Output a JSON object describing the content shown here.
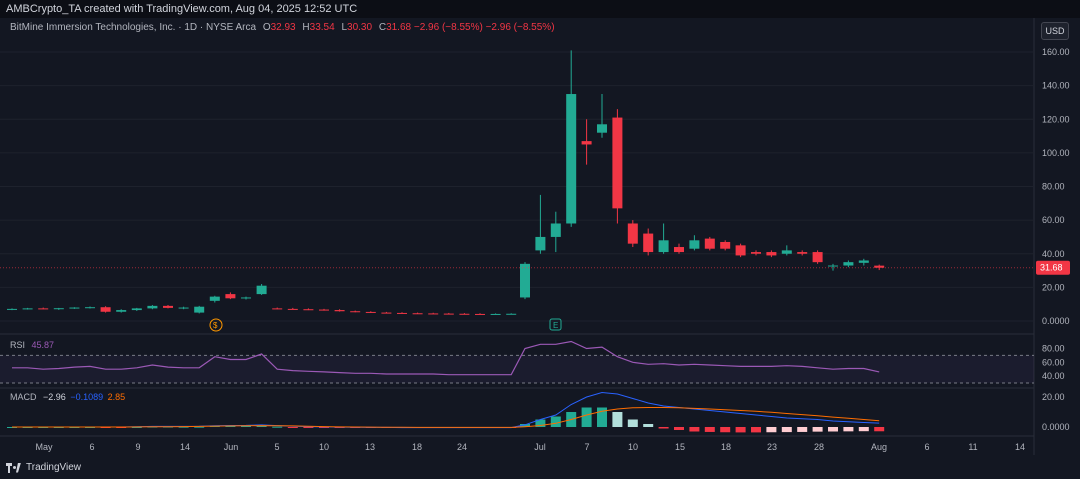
{
  "header": {
    "attribution": "AMBCrypto_TA created with TradingView.com, Aug 04, 2025 12:52 UTC"
  },
  "symbol": {
    "name": "BitMine Immersion Technologies, Inc. · 1D · NYSE Arca",
    "open_label": "O",
    "open": "32.93",
    "high_label": "H",
    "high": "33.54",
    "low_label": "L",
    "low": "30.30",
    "close_label": "C",
    "close": "31.68",
    "change": "−2.96 (−8.55%)",
    "change2": "−2.96 (−8.55%)"
  },
  "currency_button": "USD",
  "price_tag": "31.68",
  "price_axis": [
    "160.00",
    "140.00",
    "120.00",
    "100.00",
    "80.00",
    "60.00",
    "40.00",
    "20.00",
    "0.0000"
  ],
  "rsi": {
    "label": "RSI",
    "value": "45.87",
    "axis": [
      "80.00",
      "60.00",
      "40.00"
    ]
  },
  "macd": {
    "label": "MACD",
    "macd": "−2.96",
    "signal": "−0.1089",
    "hist": "2.85",
    "axis": [
      "20.00",
      "0.0000"
    ]
  },
  "time_axis": [
    "May",
    "6",
    "9",
    "14",
    "Jun",
    "5",
    "10",
    "13",
    "18",
    "24",
    "Jul",
    "7",
    "10",
    "15",
    "18",
    "23",
    "28",
    "Aug",
    "6",
    "11",
    "14"
  ],
  "markers": {
    "dividend": "$",
    "earnings": "E"
  },
  "brand": "TradingView",
  "colors": {
    "up": "#22ab94",
    "down": "#f23645",
    "rsi": "#9b59b6",
    "macd": "#2962ff",
    "signal": "#ff6d00"
  },
  "chart_data": {
    "type": "candlestick",
    "y_range": [
      0,
      165
    ],
    "candles": [
      {
        "o": 7,
        "h": 7.5,
        "l": 6.5,
        "c": 7.2
      },
      {
        "o": 7.2,
        "h": 7.8,
        "l": 6.8,
        "c": 7.5
      },
      {
        "o": 7.5,
        "h": 8,
        "l": 7,
        "c": 7.3
      },
      {
        "o": 7.3,
        "h": 7.8,
        "l": 6.6,
        "c": 7.6
      },
      {
        "o": 7.6,
        "h": 8.2,
        "l": 7.2,
        "c": 8.0
      },
      {
        "o": 8.0,
        "h": 8.6,
        "l": 7.4,
        "c": 8.2
      },
      {
        "o": 8.2,
        "h": 8.8,
        "l": 5,
        "c": 5.5
      },
      {
        "o": 5.5,
        "h": 7,
        "l": 5,
        "c": 6.5
      },
      {
        "o": 6.5,
        "h": 7.8,
        "l": 6,
        "c": 7.5
      },
      {
        "o": 7.5,
        "h": 9.5,
        "l": 7,
        "c": 9
      },
      {
        "o": 9,
        "h": 9.5,
        "l": 7.5,
        "c": 7.8
      },
      {
        "o": 7.8,
        "h": 8.5,
        "l": 7,
        "c": 8
      },
      {
        "o": 5,
        "h": 9,
        "l": 4.5,
        "c": 8.5
      },
      {
        "o": 12,
        "h": 15,
        "l": 11,
        "c": 14.5
      },
      {
        "o": 16,
        "h": 17,
        "l": 13,
        "c": 13.5
      },
      {
        "o": 13.5,
        "h": 14.5,
        "l": 12.8,
        "c": 14
      },
      {
        "o": 16,
        "h": 22,
        "l": 15.5,
        "c": 21
      },
      {
        "o": 7.5,
        "h": 8,
        "l": 7,
        "c": 7.2
      },
      {
        "o": 7.2,
        "h": 7.8,
        "l": 6.8,
        "c": 7
      },
      {
        "o": 7,
        "h": 7.5,
        "l": 6.5,
        "c": 6.8
      },
      {
        "o": 6.8,
        "h": 7.2,
        "l": 6.2,
        "c": 6.5
      },
      {
        "o": 6.5,
        "h": 7,
        "l": 5.6,
        "c": 5.8
      },
      {
        "o": 5.8,
        "h": 6.2,
        "l": 5.2,
        "c": 5.4
      },
      {
        "o": 5.4,
        "h": 5.8,
        "l": 4.8,
        "c": 5
      },
      {
        "o": 5,
        "h": 5.4,
        "l": 4.6,
        "c": 4.8
      },
      {
        "o": 4.8,
        "h": 5.2,
        "l": 4.4,
        "c": 4.6
      },
      {
        "o": 4.6,
        "h": 5,
        "l": 4.3,
        "c": 4.5
      },
      {
        "o": 4.5,
        "h": 4.9,
        "l": 4.2,
        "c": 4.4
      },
      {
        "o": 4.4,
        "h": 4.8,
        "l": 4.1,
        "c": 4.3
      },
      {
        "o": 4.3,
        "h": 4.7,
        "l": 4,
        "c": 4.2
      },
      {
        "o": 4.2,
        "h": 4.6,
        "l": 3.9,
        "c": 4.1
      },
      {
        "o": 4.1,
        "h": 4.5,
        "l": 3.9,
        "c": 4.2
      },
      {
        "o": 4.2,
        "h": 4.6,
        "l": 3.9,
        "c": 4.3
      },
      {
        "o": 14,
        "h": 35,
        "l": 13,
        "c": 34
      },
      {
        "o": 42,
        "h": 75,
        "l": 40,
        "c": 50
      },
      {
        "o": 50,
        "h": 65,
        "l": 41,
        "c": 58
      },
      {
        "o": 58,
        "h": 161,
        "l": 56,
        "c": 135
      },
      {
        "o": 107,
        "h": 120,
        "l": 93,
        "c": 105
      },
      {
        "o": 112,
        "h": 135,
        "l": 109,
        "c": 117
      },
      {
        "o": 121,
        "h": 126,
        "l": 58,
        "c": 67
      },
      {
        "o": 58,
        "h": 60,
        "l": 44,
        "c": 46
      },
      {
        "o": 52,
        "h": 55,
        "l": 39,
        "c": 41
      },
      {
        "o": 41,
        "h": 58,
        "l": 40,
        "c": 48
      },
      {
        "o": 44,
        "h": 46,
        "l": 40,
        "c": 41
      },
      {
        "o": 43,
        "h": 51,
        "l": 42,
        "c": 48
      },
      {
        "o": 49,
        "h": 50,
        "l": 42,
        "c": 43
      },
      {
        "o": 47,
        "h": 48,
        "l": 42,
        "c": 43
      },
      {
        "o": 45,
        "h": 46,
        "l": 38,
        "c": 39
      },
      {
        "o": 41,
        "h": 42,
        "l": 39,
        "c": 40
      },
      {
        "o": 41,
        "h": 42,
        "l": 38,
        "c": 39
      },
      {
        "o": 40,
        "h": 45,
        "l": 39,
        "c": 42
      },
      {
        "o": 41,
        "h": 42,
        "l": 39,
        "c": 40
      },
      {
        "o": 41,
        "h": 42,
        "l": 34,
        "c": 35
      },
      {
        "o": 33,
        "h": 34,
        "l": 30,
        "c": 33
      },
      {
        "o": 33,
        "h": 36,
        "l": 32,
        "c": 35
      },
      {
        "o": 34.6,
        "h": 37,
        "l": 33,
        "c": 36
      },
      {
        "o": 32.93,
        "h": 33.54,
        "l": 30.3,
        "c": 31.68
      }
    ]
  }
}
